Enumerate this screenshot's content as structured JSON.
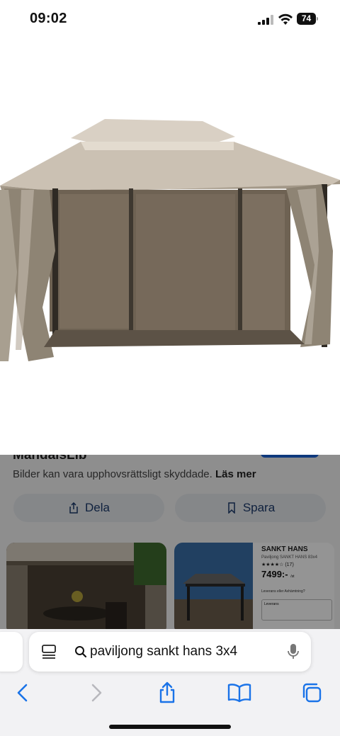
{
  "status_bar": {
    "time": "09:02",
    "battery": "74"
  },
  "hero_image": {
    "description_icon": "gazebo-photo"
  },
  "sheet": {
    "source_title": "MandalsLib",
    "copyright_text": "Bilder kan vara upphovsrättsligt skyddade.",
    "learn_more": "Läs mer",
    "share_label": "Dela",
    "save_label": "Spara",
    "related": {
      "product_title": "SANKT HANS",
      "product_sub": "Paviljong SANKT HANS 83x4",
      "rating_text": "★★★★☆ (17)",
      "price": "7499:-",
      "price_unit": "/st",
      "delivery_line": "Leverans eller Avhämtning?",
      "delivery_box": "Leverans"
    }
  },
  "address_bar": {
    "query": "paviljong sankt hans 3x4"
  },
  "colors": {
    "accent": "#1b63d8",
    "toolbar_icon": "#1a73e8"
  }
}
